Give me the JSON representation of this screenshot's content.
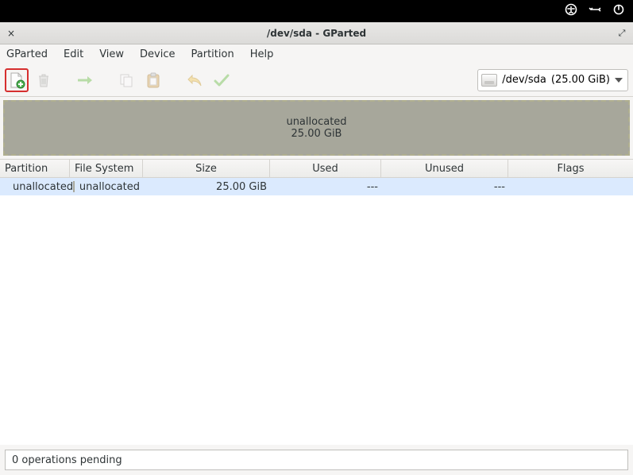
{
  "system_tray": {
    "accessibility": "accessibility",
    "network": "network",
    "power": "power"
  },
  "window": {
    "title": "/dev/sda - GParted",
    "close": "×",
    "restore": "⇲"
  },
  "menus": [
    "GParted",
    "Edit",
    "View",
    "Device",
    "Partition",
    "Help"
  ],
  "toolbar": {
    "new": "new-partition",
    "delete": "delete",
    "resize": "resize-move",
    "copy": "copy",
    "paste": "paste",
    "undo": "undo",
    "apply": "apply"
  },
  "device_selector": {
    "device": "/dev/sda",
    "size": "(25.00 GiB)"
  },
  "graph": {
    "label": "unallocated",
    "size": "25.00 GiB"
  },
  "columns": {
    "partition": "Partition",
    "filesystem": "File System",
    "size": "Size",
    "used": "Used",
    "unused": "Unused",
    "flags": "Flags"
  },
  "rows": [
    {
      "partition": "unallocated",
      "filesystem": "unallocated",
      "size": "25.00 GiB",
      "used": "---",
      "unused": "---",
      "flags": ""
    }
  ],
  "status": "0 operations pending"
}
